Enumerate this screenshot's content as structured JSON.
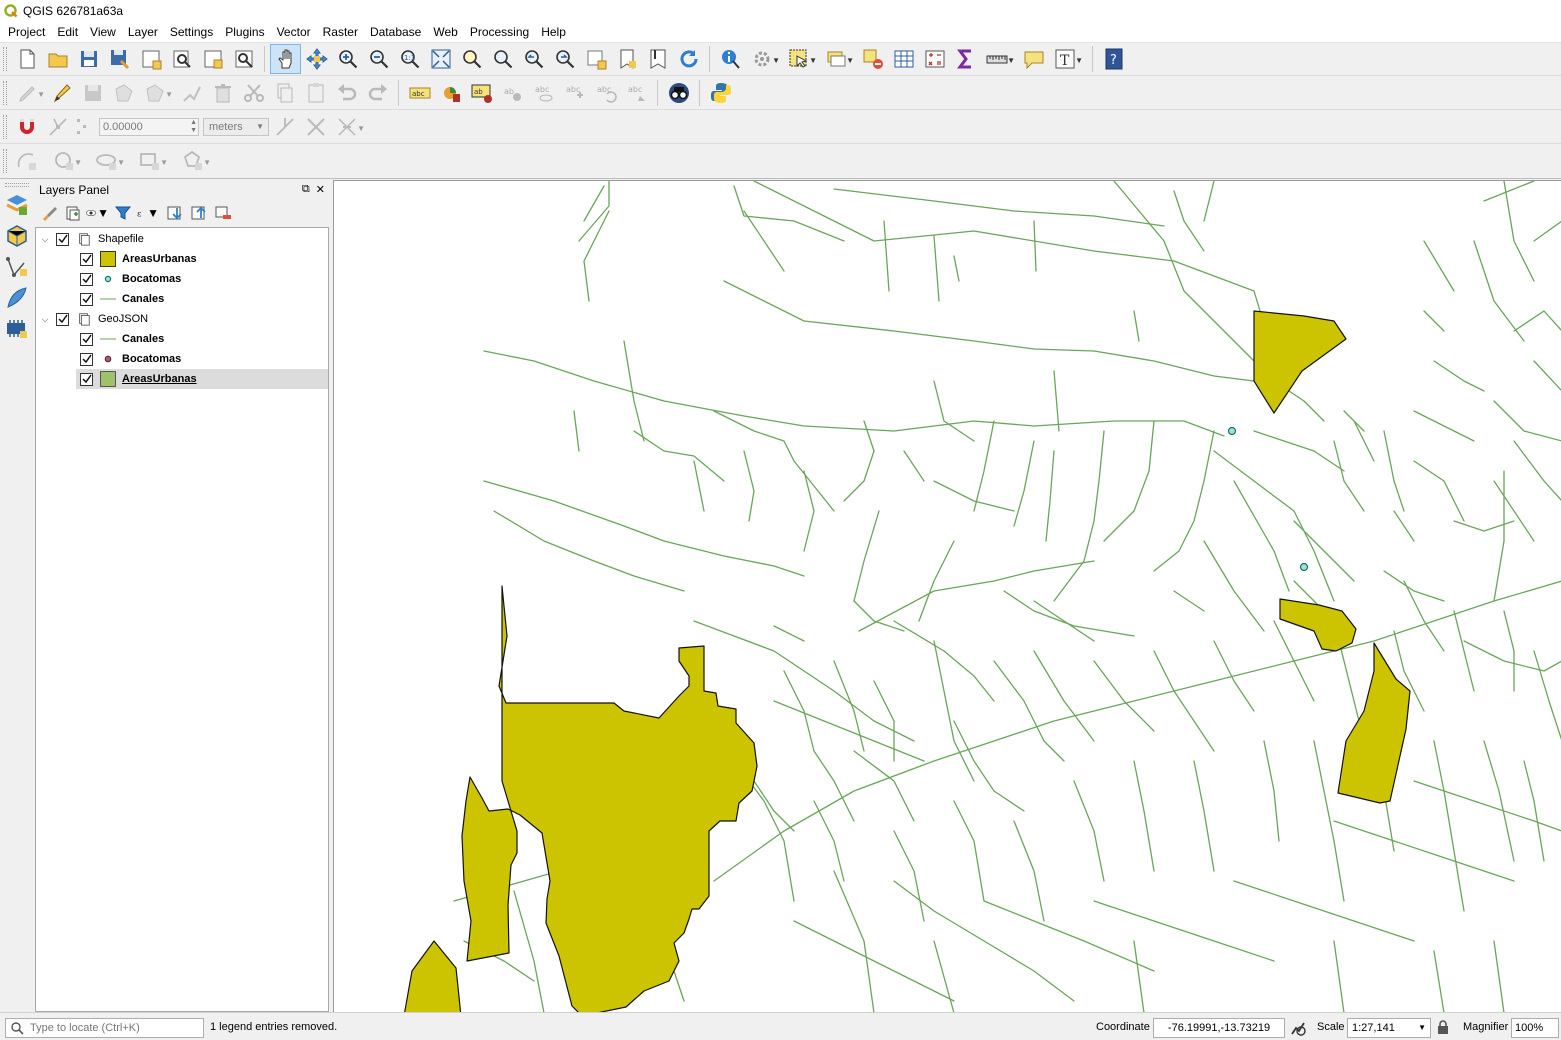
{
  "app": {
    "title": "QGIS 626781a63a",
    "accent": "#cde4f7"
  },
  "menu": [
    "Project",
    "Edit",
    "View",
    "Layer",
    "Settings",
    "Plugins",
    "Vector",
    "Raster",
    "Database",
    "Web",
    "Processing",
    "Help"
  ],
  "snapping": {
    "tolerance": "0.00000",
    "units": "meters"
  },
  "layers_panel": {
    "title": "Layers Panel",
    "groups": [
      {
        "name": "Shapefile",
        "checked": true,
        "layers": [
          {
            "name": "AreasUrbanas",
            "symbol": "polygon",
            "color": "#cdc400",
            "checked": true
          },
          {
            "name": "Bocatomas",
            "symbol": "point",
            "color": "#4fc9b0",
            "checked": true
          },
          {
            "name": "Canales",
            "symbol": "line",
            "color": "#6aa55a",
            "checked": true
          }
        ]
      },
      {
        "name": "GeoJSON",
        "checked": true,
        "layers": [
          {
            "name": "Canales",
            "symbol": "line",
            "color": "#6aa55a",
            "checked": true
          },
          {
            "name": "Bocatomas",
            "symbol": "point",
            "color": "#b05a7a",
            "checked": true
          },
          {
            "name": "AreasUrbanas",
            "symbol": "polygon",
            "color": "#9ec26a",
            "checked": true,
            "selected": true
          }
        ]
      }
    ]
  },
  "map": {
    "canal_color": "#6aa55a",
    "area_fill": "#cdc400",
    "point_fill": "#9be3d3"
  },
  "status": {
    "locator_placeholder": "Type to locate (Ctrl+K)",
    "message": "1 legend entries removed.",
    "coordinate_label": "Coordinate",
    "coordinate": "-76.19991,-13.73219",
    "scale_label": "Scale",
    "scale": "1:27,141",
    "magnifier_label": "Magnifier",
    "magnifier": "100%"
  }
}
